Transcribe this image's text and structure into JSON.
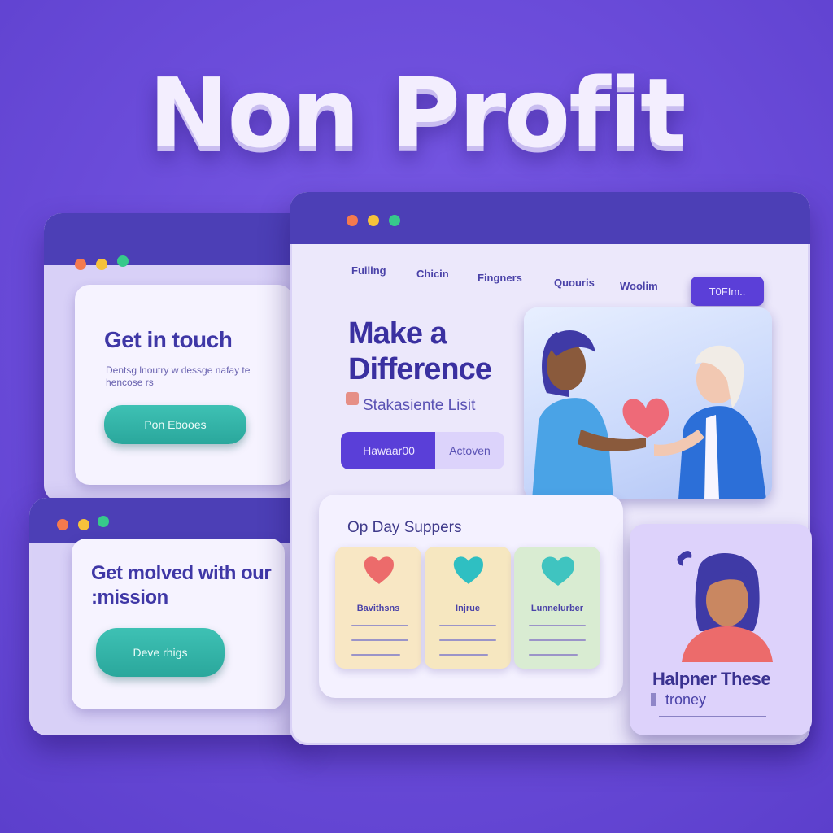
{
  "hero": {
    "title": "Non Profit"
  },
  "contact_window": {
    "title": "Get in touch",
    "text": "Dentsg lnoutry w dessge nafay te hencose rs",
    "button_label": "Pon Ebooes"
  },
  "involve_window": {
    "title": "Get molved with our :mission",
    "button_label": "Deve rhigs"
  },
  "main_window": {
    "nav": {
      "items": [
        "Fuiling",
        "Chicin",
        "Fingners",
        "Quouris",
        "Woolim"
      ],
      "cta_label": "T0FIm.."
    },
    "headline": "Make a Difference",
    "subheadline": "Stakasiente Lisit",
    "segmented": {
      "primary_label": "Hawaar00",
      "secondary_label": "Actoven"
    },
    "supporters": {
      "title": "Op Day Suppers",
      "cards": [
        {
          "label": "Bavithsns",
          "color": "#f8e7c4",
          "icon_color": "#ec6b6b"
        },
        {
          "label": "Injrue",
          "color": "#f6e7c0",
          "icon_color": "#2fbfc2"
        },
        {
          "label": "Lunnelurber",
          "color": "#d9ecd2",
          "icon_color": "#3fc4c0"
        }
      ]
    }
  },
  "profile_card": {
    "name": "Halpner These",
    "subtitle": "troney"
  }
}
